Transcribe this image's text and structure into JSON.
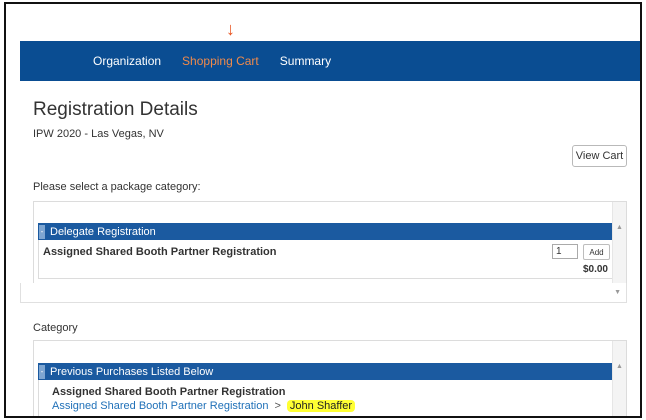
{
  "annotation": {
    "arrow_glyph": "↓",
    "arrow_color": "#e8531f"
  },
  "colors": {
    "navbar": "#0a4d92",
    "nav_active": "#f08a4b",
    "category_header": "#1b5aa0",
    "link": "#1f70b8",
    "highlight": "#ffff33"
  },
  "nav": {
    "items": [
      {
        "label": "Organization",
        "active": false
      },
      {
        "label": "Shopping Cart",
        "active": true
      },
      {
        "label": "Summary",
        "active": false
      }
    ]
  },
  "page": {
    "title": "Registration Details",
    "subtitle": "IPW 2020 - Las Vegas, NV",
    "view_cart_label": "View Cart",
    "prompt": "Please select a package category:"
  },
  "package_panel": {
    "category_header": "Delegate Registration",
    "item_name": "Assigned Shared Booth Partner Registration",
    "quantity": "1",
    "add_label": "Add",
    "price": "$0.00"
  },
  "category_section": {
    "label": "Category",
    "header": "Previous Purchases Listed Below",
    "item_name": "Assigned Shared Booth Partner Registration",
    "breadcrumb": {
      "link": "Assigned Shared Booth Partner Registration",
      "separator": ">",
      "highlighted": "John Shaffer"
    }
  },
  "icons": {
    "collapse": "minus-icon",
    "scroll_up": "scroll-up-arrow-icon",
    "scroll_down": "scroll-down-arrow-icon"
  }
}
